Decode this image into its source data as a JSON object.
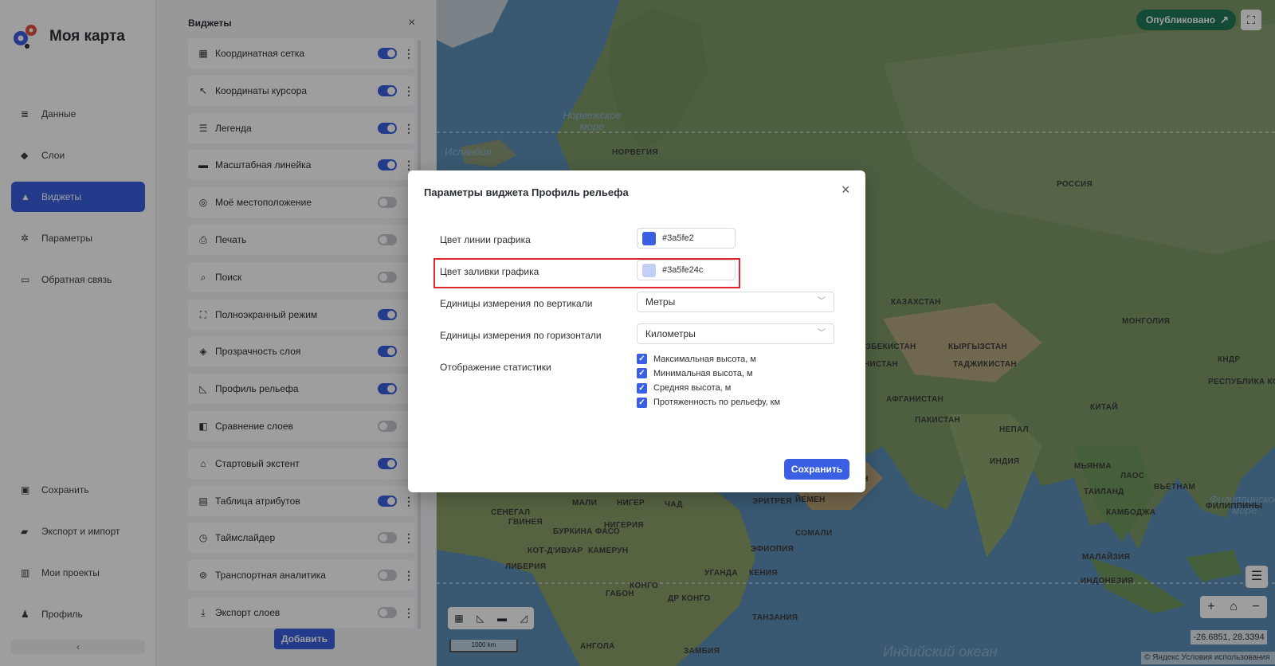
{
  "app": {
    "title": "Моя карта"
  },
  "sidebar": {
    "items": [
      {
        "label": "Данные",
        "icon": "database-icon"
      },
      {
        "label": "Слои",
        "icon": "layers-icon"
      },
      {
        "label": "Виджеты",
        "icon": "widgets-icon",
        "active": true
      },
      {
        "label": "Параметры",
        "icon": "gear-icon"
      },
      {
        "label": "Обратная связь",
        "icon": "feedback-icon"
      }
    ],
    "bottom_items": [
      {
        "label": "Сохранить",
        "icon": "save-icon"
      },
      {
        "label": "Экспорт и импорт",
        "icon": "folder-icon"
      },
      {
        "label": "Мои проекты",
        "icon": "projects-icon"
      },
      {
        "label": "Профиль",
        "icon": "profile-icon"
      }
    ],
    "collapse_glyph": "‹"
  },
  "widgets_panel": {
    "title": "Виджеты",
    "close_glyph": "×",
    "add_label": "Добавить",
    "items": [
      {
        "label": "Координатная сетка",
        "icon": "grid-icon",
        "glyph": "▦",
        "on": true
      },
      {
        "label": "Координаты курсора",
        "icon": "cursor-icon",
        "glyph": "↖",
        "on": true
      },
      {
        "label": "Легенда",
        "icon": "list-icon",
        "glyph": "☰",
        "on": true
      },
      {
        "label": "Масштабная линейка",
        "icon": "ruler-icon",
        "glyph": "▬",
        "on": true
      },
      {
        "label": "Моё местоположение",
        "icon": "location-icon",
        "glyph": "◎",
        "on": false
      },
      {
        "label": "Печать",
        "icon": "print-icon",
        "glyph": "⎙",
        "on": false
      },
      {
        "label": "Поиск",
        "icon": "search-icon",
        "glyph": "⌕",
        "on": false
      },
      {
        "label": "Полноэкранный режим",
        "icon": "fullscreen-icon",
        "glyph": "⛶",
        "on": true
      },
      {
        "label": "Прозрачность слоя",
        "icon": "drop-icon",
        "glyph": "◈",
        "on": true
      },
      {
        "label": "Профиль рельефа",
        "icon": "chart-icon",
        "glyph": "◺",
        "on": true
      },
      {
        "label": "Сравнение слоев",
        "icon": "compare-icon",
        "glyph": "◧",
        "on": false
      },
      {
        "label": "Стартовый экстент",
        "icon": "home-icon",
        "glyph": "⌂",
        "on": true
      },
      {
        "label": "Таблица атрибутов",
        "icon": "table-icon",
        "glyph": "▤",
        "on": true
      },
      {
        "label": "Таймслайдер",
        "icon": "clock-icon",
        "glyph": "◷",
        "on": false
      },
      {
        "label": "Транспортная аналитика",
        "icon": "transport-icon",
        "glyph": "⊚",
        "on": false
      },
      {
        "label": "Экспорт слоев",
        "icon": "download-icon",
        "glyph": "⤓",
        "on": false
      }
    ]
  },
  "map": {
    "published_label": "Опубликовано",
    "coords": "-26.6851, 28.3394",
    "copyright": "© Яндекс Условия использования",
    "scale_label": "1000 km",
    "labels": [
      {
        "text": "Норвежское море",
        "cls": "sea"
      },
      {
        "text": "Исландия",
        "cls": "sea"
      },
      {
        "text": "НОРВЕГИЯ",
        "cls": "maptext"
      },
      {
        "text": "РОССИЯ",
        "cls": "maptext"
      },
      {
        "text": "КАЗАХСТАН",
        "cls": "maptext"
      },
      {
        "text": "МОНГОЛИЯ",
        "cls": "maptext"
      },
      {
        "text": "УЗБЕКИСТАН",
        "cls": "maptext"
      },
      {
        "text": "КЫРГЫЗСТАН",
        "cls": "maptext"
      },
      {
        "text": "ТАДЖИКИСТАН",
        "cls": "maptext"
      },
      {
        "text": "ТУРКМЕНИСТАН",
        "cls": "maptext"
      },
      {
        "text": "АФГАНИСТАН",
        "cls": "maptext"
      },
      {
        "text": "ПАКИСТАН",
        "cls": "maptext"
      },
      {
        "text": "НЕПАЛ",
        "cls": "maptext"
      },
      {
        "text": "КИТАЙ",
        "cls": "maptext"
      },
      {
        "text": "ИНДИЯ",
        "cls": "maptext"
      },
      {
        "text": "МЬЯНМА",
        "cls": "maptext"
      },
      {
        "text": "ЛАОС",
        "cls": "maptext"
      },
      {
        "text": "ТАИЛАНД",
        "cls": "maptext"
      },
      {
        "text": "ВЬЕТНАМ",
        "cls": "maptext"
      },
      {
        "text": "КАМБОДЖА",
        "cls": "maptext"
      },
      {
        "text": "ФИЛИППИНЫ",
        "cls": "maptext"
      },
      {
        "text": "МАЛАЙЗИЯ",
        "cls": "maptext"
      },
      {
        "text": "ИНДОНЕЗИЯ",
        "cls": "maptext"
      },
      {
        "text": "КНДР",
        "cls": "maptext"
      },
      {
        "text": "РЕСПУБЛИКА КОРЕЯ",
        "cls": "maptext"
      },
      {
        "text": "ОМАН",
        "cls": "maptext"
      },
      {
        "text": "ЙЕМЕН",
        "cls": "maptext"
      },
      {
        "text": "СОМАЛИ",
        "cls": "maptext"
      },
      {
        "text": "ЭФИОПИЯ",
        "cls": "maptext"
      },
      {
        "text": "КЕНИЯ",
        "cls": "maptext"
      },
      {
        "text": "УГАНДА",
        "cls": "maptext"
      },
      {
        "text": "ТАНЗАНИЯ",
        "cls": "maptext"
      },
      {
        "text": "ЗАМБИЯ",
        "cls": "maptext"
      },
      {
        "text": "АНГОЛА",
        "cls": "maptext"
      },
      {
        "text": "ДР КОНГО",
        "cls": "maptext"
      },
      {
        "text": "КОНГО",
        "cls": "maptext"
      },
      {
        "text": "ГАБОН",
        "cls": "maptext"
      },
      {
        "text": "КАМЕРУН",
        "cls": "maptext"
      },
      {
        "text": "НИГЕРИЯ",
        "cls": "maptext"
      },
      {
        "text": "НИГЕР",
        "cls": "maptext"
      },
      {
        "text": "ЧАД",
        "cls": "maptext"
      },
      {
        "text": "СУДАН",
        "cls": "maptext"
      },
      {
        "text": "ЭРИТРЕЯ",
        "cls": "maptext"
      },
      {
        "text": "МАЛИ",
        "cls": "maptext"
      },
      {
        "text": "СЕНЕГАЛ",
        "cls": "maptext"
      },
      {
        "text": "ГВИНЕЯ",
        "cls": "maptext"
      },
      {
        "text": "БУРКИНА ФАСО",
        "cls": "maptext"
      },
      {
        "text": "КОТ-Д'ИВУАР",
        "cls": "maptext"
      },
      {
        "text": "ЛИБЕРИЯ",
        "cls": "maptext"
      },
      {
        "text": "Индийский океан",
        "cls": "sea"
      },
      {
        "text": "Филиппинское море",
        "cls": "sea"
      }
    ]
  },
  "dialog": {
    "title": "Параметры виджета Профиль рельефа",
    "close_glyph": "×",
    "line_color_label": "Цвет линии графика",
    "line_color_value": "#3a5fe2",
    "fill_color_label": "Цвет заливки графика",
    "fill_color_value": "#3a5fe24c",
    "vertical_units_label": "Единицы измерения по вертикали",
    "vertical_units_value": "Метры",
    "horizontal_units_label": "Единицы измерения по горизонтали",
    "horizontal_units_value": "Километры",
    "stats_label": "Отображение статистики",
    "stats_options": [
      {
        "label": "Максимальная высота, м",
        "checked": true
      },
      {
        "label": "Минимальная высота, м",
        "checked": true
      },
      {
        "label": "Средняя высота, м",
        "checked": true
      },
      {
        "label": "Протяженность по рельефу, км",
        "checked": true
      }
    ],
    "save_label": "Сохранить"
  },
  "colors": {
    "accent": "#3a5fe2",
    "published": "#1f7a5a",
    "highlight": "#e0262b"
  }
}
